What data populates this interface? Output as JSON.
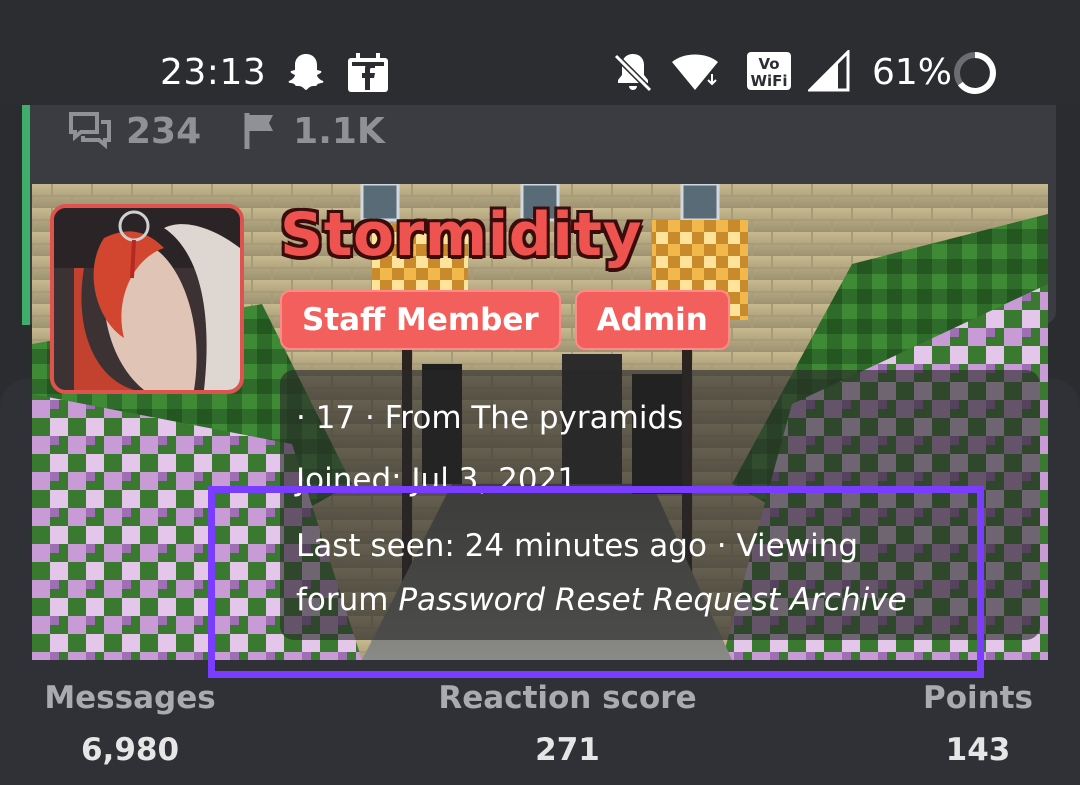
{
  "status_bar": {
    "time": "23:13",
    "battery": "61%",
    "icons": [
      "snapchat-icon",
      "facebook-store-icon",
      "mute-bell-icon",
      "wifi-icon",
      "vowifi-icon",
      "signal-icon",
      "battery-ring-icon"
    ]
  },
  "thread": {
    "replies": "234",
    "views": "1.1K",
    "accent_color": "#3fae6a"
  },
  "profile": {
    "username": "Stormidity",
    "username_color": "#ef5350",
    "badges": [
      "Staff Member",
      "Admin"
    ],
    "badge_color": "#f25f5c",
    "info_line1": "· 17 · From The pyramids",
    "info_line2": "Joined: Jul 3, 2021",
    "info_line3": "Last seen: 24 minutes ago · Viewing",
    "info_line4_prefix": "forum ",
    "info_line4_forum": "Password Reset Request Archive",
    "highlight_color": "#7a3cff"
  },
  "stats": {
    "messages_label": "Messages",
    "messages_value": "6,980",
    "reaction_label": "Reaction score",
    "reaction_value": "271",
    "points_label": "Points",
    "points_value": "143"
  }
}
